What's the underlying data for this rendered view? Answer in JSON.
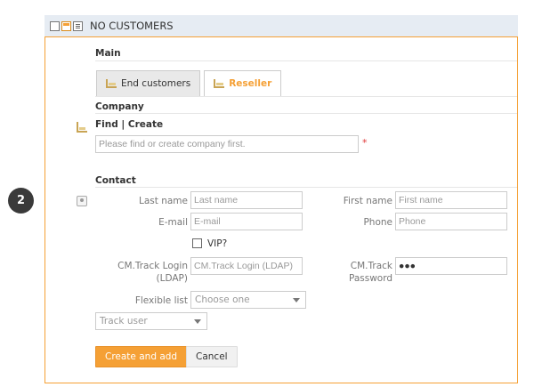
{
  "step": {
    "number": "2"
  },
  "header": {
    "title": "NO CUSTOMERS",
    "view_icons": [
      "grid-view-icon",
      "card-view-icon",
      "list-view-icon"
    ]
  },
  "colors": {
    "accent": "#f5a035",
    "required": "#e03a3a",
    "border": "#cccccc"
  },
  "main": {
    "section_title": "Main",
    "tabs": [
      {
        "label": "End customers",
        "active": false
      },
      {
        "label": "Reseller",
        "active": true
      }
    ]
  },
  "company": {
    "section_title": "Company",
    "find_create_label": "Find | Create",
    "search": {
      "placeholder": "Please find or create company first.",
      "value": "",
      "required": "*"
    }
  },
  "contact": {
    "section_title": "Contact",
    "last_name": {
      "label": "Last name",
      "placeholder": "Last name",
      "value": ""
    },
    "first_name": {
      "label": "First name",
      "placeholder": "First name",
      "value": ""
    },
    "email": {
      "label": "E-mail",
      "placeholder": "E-mail",
      "value": ""
    },
    "phone": {
      "label": "Phone",
      "placeholder": "Phone",
      "value": ""
    },
    "vip": {
      "label": "VIP?",
      "checked": false
    },
    "login": {
      "label": "CM.Track Login (LDAP)",
      "placeholder": "CM.Track Login (LDAP)",
      "value": ""
    },
    "password": {
      "label": "CM.Track Password",
      "value": "●●●"
    },
    "flexible_list": {
      "label": "Flexible list",
      "selected": "Choose one"
    },
    "track_user": {
      "selected": "Track user"
    }
  },
  "actions": {
    "create_add": "Create and add",
    "cancel": "Cancel"
  }
}
